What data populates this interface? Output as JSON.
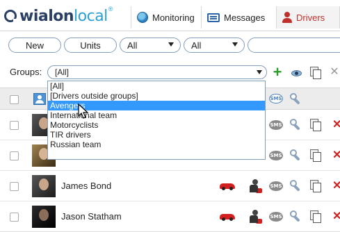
{
  "brand": {
    "name_dark": "wialon",
    "name_light": "local",
    "mark": "®"
  },
  "nav": {
    "tabs": [
      {
        "label": "Monitoring",
        "icon": "globe-icon",
        "active": false
      },
      {
        "label": "Messages",
        "icon": "messages-icon",
        "active": false
      },
      {
        "label": "Drivers",
        "icon": "driver-icon",
        "active": true
      }
    ]
  },
  "filters": {
    "new_label": "New",
    "units_label": "Units",
    "select1_value": "All",
    "select2_value": "All"
  },
  "groups": {
    "label": "Groups:",
    "selected": "[All]",
    "options": [
      "[All]",
      "[Drivers outside groups]",
      "Avengers",
      "International team",
      "Motorcyclists",
      "TIR drivers",
      "Russian team"
    ],
    "highlighted_index": 2
  },
  "header": {
    "sms_label": "SMS"
  },
  "drivers": [
    {
      "name": ""
    },
    {
      "name": ""
    },
    {
      "name": "James Bond",
      "sms_label": "SMS"
    },
    {
      "name": "Jason Statham",
      "sms_label": "SMS"
    }
  ],
  "colors": {
    "accent": "#c0302b",
    "brand_dark": "#2a3f64",
    "brand_light": "#2aa0d8",
    "highlight": "#3399ff",
    "delete": "#d31f1f"
  }
}
